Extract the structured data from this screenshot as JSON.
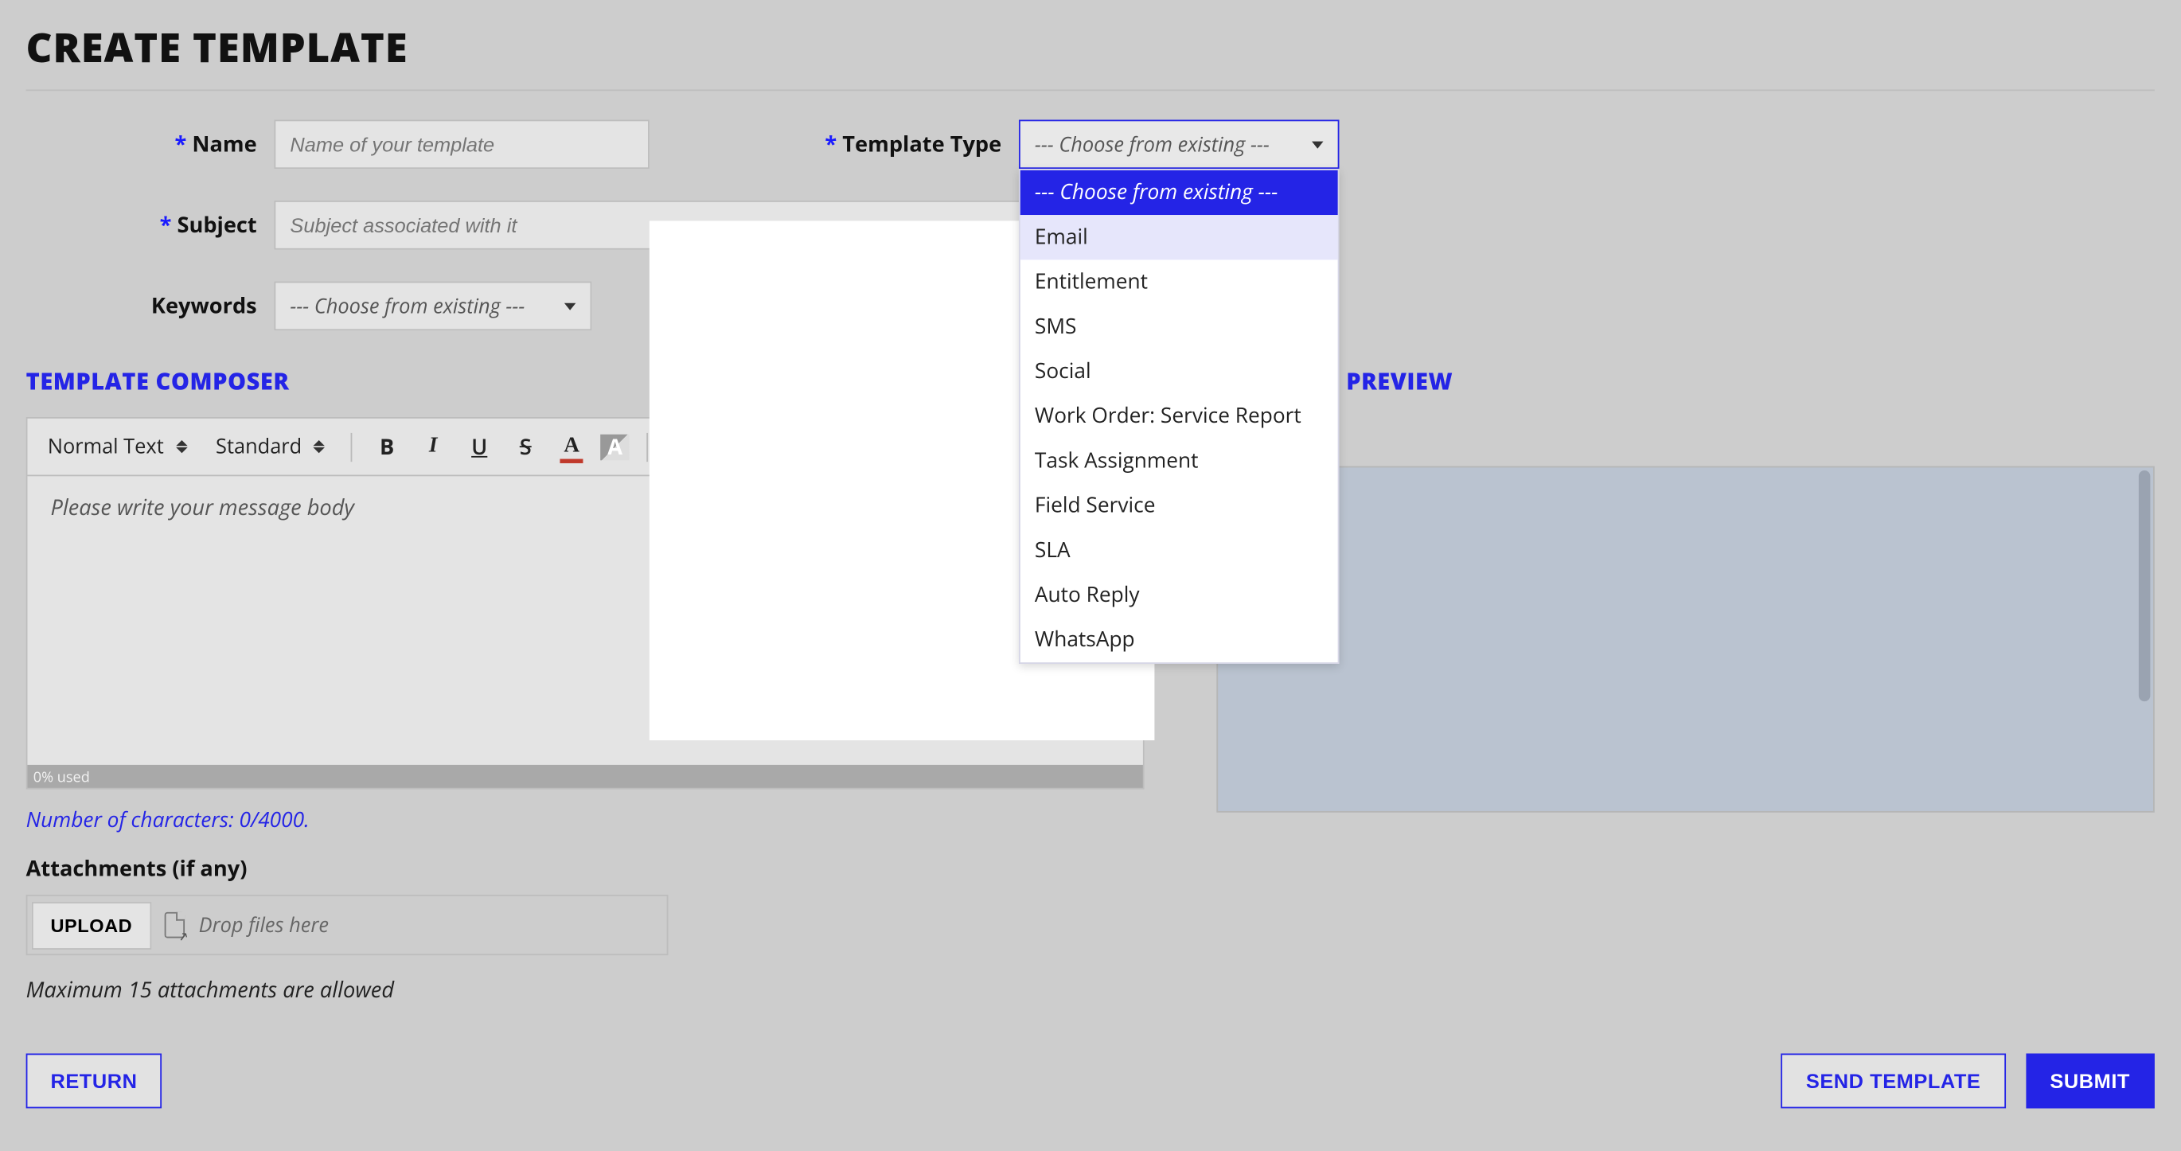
{
  "page_title": "CREATE TEMPLATE",
  "fields": {
    "name": {
      "label": "Name",
      "placeholder": "Name of your template"
    },
    "template_type": {
      "label": "Template Type",
      "selected": "--- Choose from existing ---",
      "options": [
        "--- Choose from existing ---",
        "Email",
        "Entitlement",
        "SMS",
        "Social",
        "Work Order: Service Report",
        "Task Assignment",
        "Field Service",
        "SLA",
        "Auto Reply",
        "WhatsApp"
      ],
      "hovered": "Email"
    },
    "subject": {
      "label": "Subject",
      "placeholder": "Subject associated with it"
    },
    "keywords": {
      "label": "Keywords",
      "placeholder": "--- Choose from existing ---"
    }
  },
  "composer": {
    "title": "TEMPLATE COMPOSER",
    "style_select": "Normal Text",
    "font_select": "Standard",
    "body_placeholder": "Please write your message body",
    "usage": "0% used",
    "char_count": "Number of characters: 0/4000."
  },
  "attachments": {
    "label": "Attachments (if any)",
    "upload_label": "UPLOAD",
    "drop_label": "Drop files here",
    "max_label": "Maximum 15 attachments are allowed"
  },
  "preview": {
    "title": "TEMPLATE PREVIEW"
  },
  "buttons": {
    "return": "RETURN",
    "send": "SEND TEMPLATE",
    "submit": "SUBMIT"
  }
}
